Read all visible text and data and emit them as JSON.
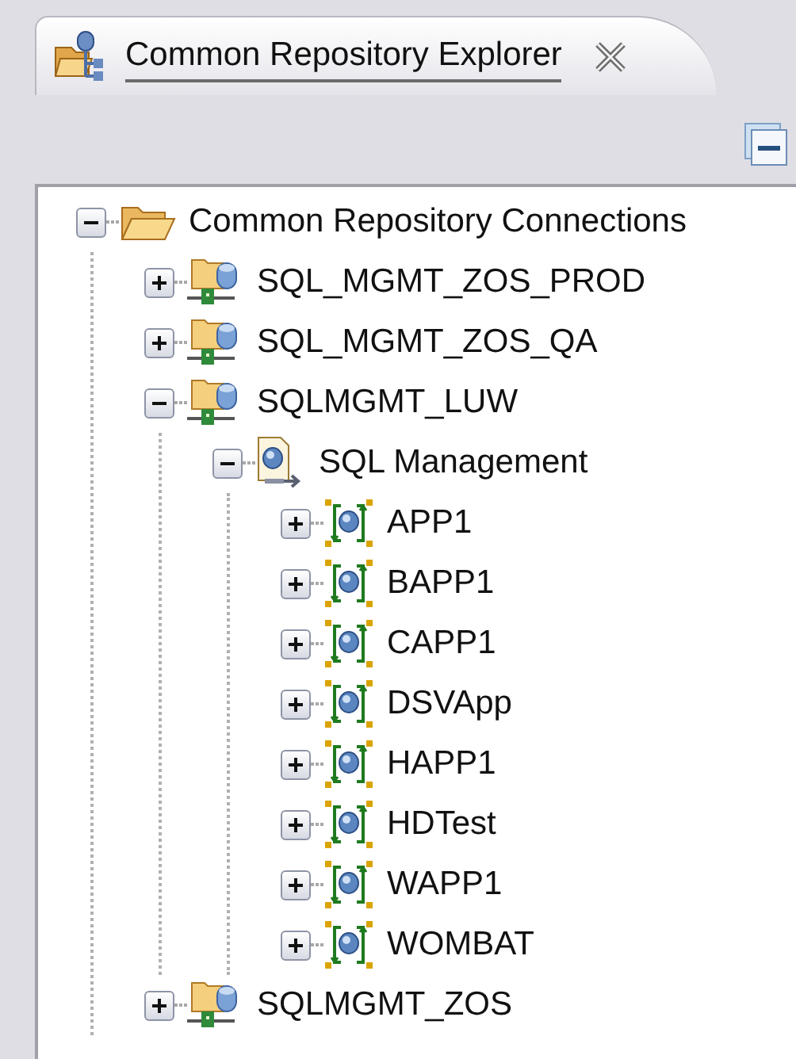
{
  "view": {
    "title": "Common Repository Explorer"
  },
  "tree": [
    {
      "label": "Common Repository Connections",
      "kind": "folder",
      "expanded": true,
      "children": [
        {
          "label": "SQL_MGMT_ZOS_PROD",
          "kind": "connection",
          "expanded": false
        },
        {
          "label": "SQL_MGMT_ZOS_QA",
          "kind": "connection",
          "expanded": false
        },
        {
          "label": "SQLMGMT_LUW",
          "kind": "connection",
          "expanded": true,
          "children": [
            {
              "label": "SQL Management",
              "kind": "management",
              "expanded": true,
              "children": [
                {
                  "label": "APP1",
                  "kind": "application",
                  "expanded": false
                },
                {
                  "label": "BAPP1",
                  "kind": "application",
                  "expanded": false
                },
                {
                  "label": "CAPP1",
                  "kind": "application",
                  "expanded": false
                },
                {
                  "label": "DSVApp",
                  "kind": "application",
                  "expanded": false
                },
                {
                  "label": "HAPP1",
                  "kind": "application",
                  "expanded": false
                },
                {
                  "label": "HDTest",
                  "kind": "application",
                  "expanded": false
                },
                {
                  "label": "WAPP1",
                  "kind": "application",
                  "expanded": false
                },
                {
                  "label": "WOMBAT",
                  "kind": "application",
                  "expanded": false
                }
              ]
            }
          ]
        },
        {
          "label": "SQLMGMT_ZOS",
          "kind": "connection",
          "expanded": false
        }
      ]
    }
  ]
}
